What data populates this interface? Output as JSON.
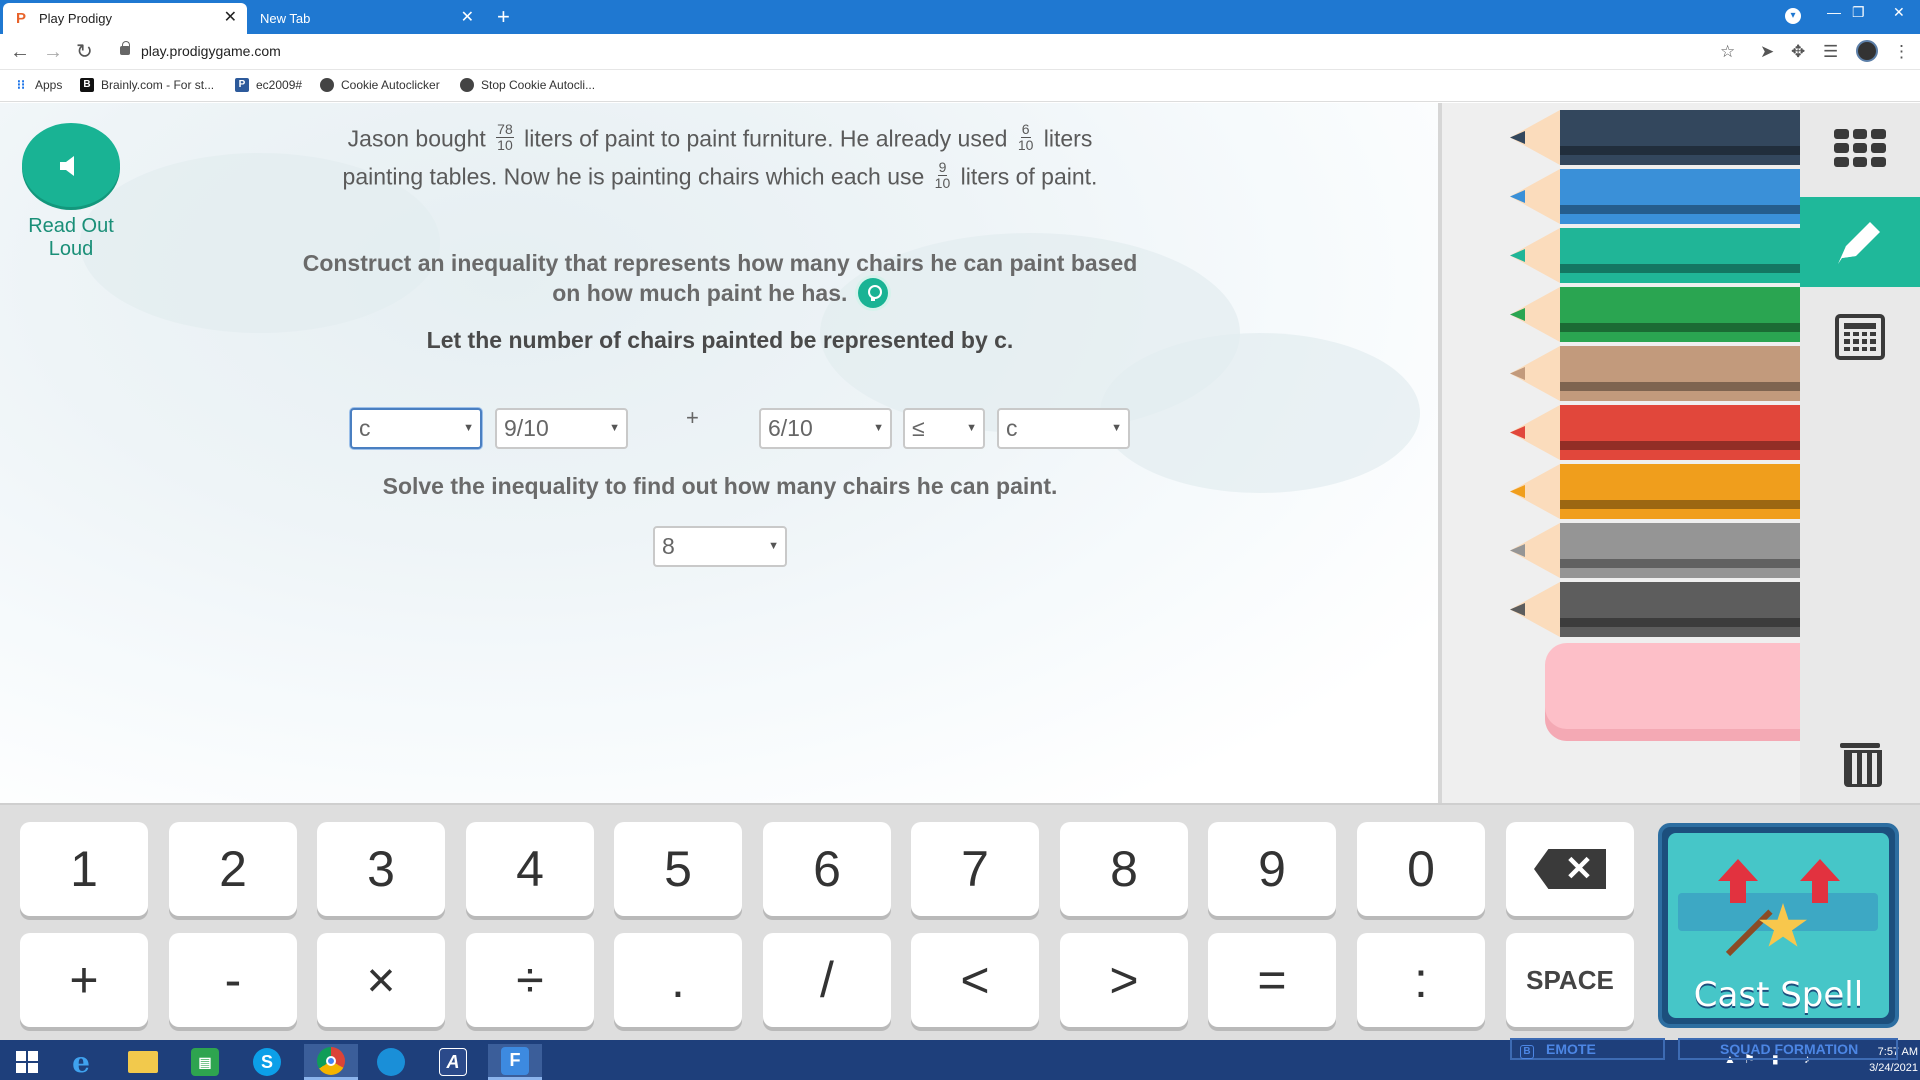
{
  "browser": {
    "tabs": [
      {
        "label": "Play Prodigy",
        "active": true
      },
      {
        "label": "New Tab",
        "active": false
      }
    ],
    "url": "play.prodigygame.com",
    "bookmarks": [
      "Apps",
      "Brainly.com - For st...",
      "ec2009#",
      "Cookie Autoclicker",
      "Stop Cookie Autocli..."
    ]
  },
  "game": {
    "read_out_loud": "Read Out Loud",
    "question": {
      "p1": "Jason bought",
      "f1": {
        "num": "78",
        "den": "10"
      },
      "p2": "liters of paint to paint furniture. He already used",
      "f2": {
        "num": "6",
        "den": "10"
      },
      "p3": "liters",
      "p4": "painting tables. Now he is painting chairs which each use",
      "f3": {
        "num": "9",
        "den": "10"
      },
      "p5": "liters of paint."
    },
    "instruction_line1": "Construct an inequality that represents how many chairs he can paint based",
    "instruction_line2": "on how much paint he has.",
    "let_line": "Let the number of chairs painted be represented by c.",
    "dropdowns": [
      "c",
      "9/10",
      "6/10",
      "≤",
      "c"
    ],
    "plus": "+",
    "solve_line": "Solve the inequality to find out how many chairs he can paint.",
    "answer_dropdown": "8"
  },
  "pencil_colors": [
    "#33475d",
    "#3a90d8",
    "#20b597",
    "#2aa551",
    "#c29a7c",
    "#e1473b",
    "#f09e1c",
    "#959595",
    "#5d5d5d"
  ],
  "keyboard": {
    "row1": [
      "1",
      "2",
      "3",
      "4",
      "5",
      "6",
      "7",
      "8",
      "9",
      "0"
    ],
    "row2": [
      "+",
      "-",
      "×",
      "÷",
      ".",
      "/",
      "<",
      ">",
      "=",
      ":"
    ],
    "space": "SPACE",
    "backspace_glyph": "✕",
    "cast_spell": "Cast Spell"
  },
  "taskbar": {
    "emote": "EMOTE",
    "squad": "SQUAD FORMATION",
    "time": "7:57 AM",
    "date": "3/24/2021"
  }
}
